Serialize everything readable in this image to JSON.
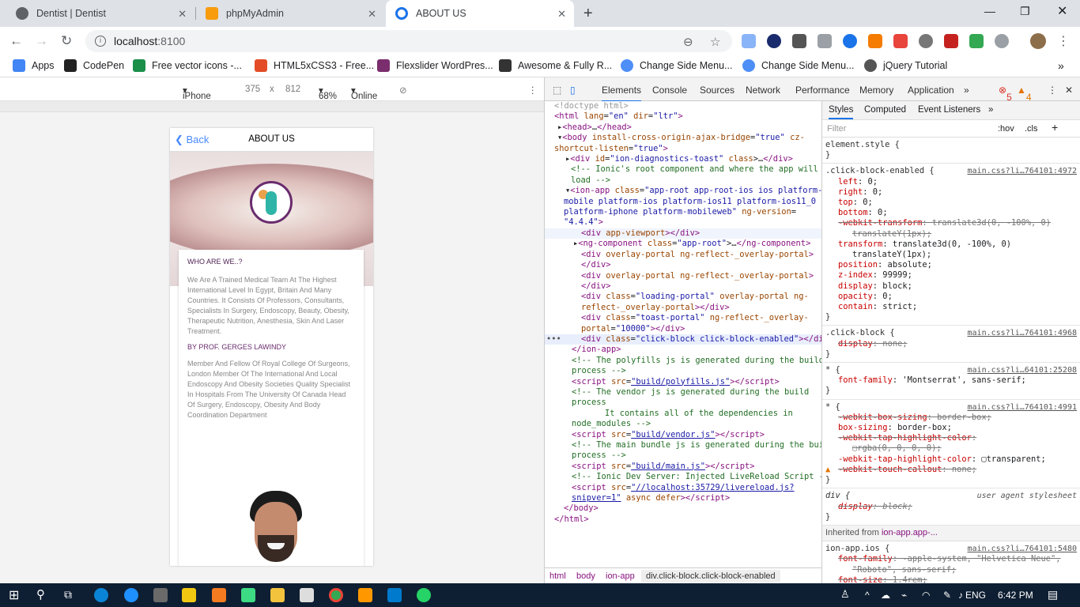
{
  "tabs": [
    {
      "title": "Dentist | Dentist",
      "icon": "globe-icon",
      "active": false
    },
    {
      "title": "phpMyAdmin",
      "icon": "phpmyadmin-icon",
      "active": false
    },
    {
      "title": "ABOUT US",
      "icon": "chrome-page-icon",
      "active": true
    }
  ],
  "address": {
    "host": "localhost",
    "port": ":8100"
  },
  "bookmarks": [
    {
      "label": "Apps",
      "icon": "apps-grid-icon",
      "color": "#4285f4"
    },
    {
      "label": "CodePen",
      "icon": "codepen-icon",
      "color": "#222222"
    },
    {
      "label": "Free vector icons -...",
      "icon": "vector-icon",
      "color": "#1a8f4a"
    },
    {
      "label": "HTML5xCSS3 - Free...",
      "icon": "x-icon",
      "color": "#e34c26"
    },
    {
      "label": "Flexslider WordPres...",
      "icon": "wordpress-icon",
      "color": "#7b2e6e"
    },
    {
      "label": "Awesome & Fully R...",
      "icon": "swirl-icon",
      "color": "#333333"
    },
    {
      "label": "Change Side Menu...",
      "icon": "ionic-icon",
      "color": "#4e8ef7"
    },
    {
      "label": "Change Side Menu...",
      "icon": "ionic-icon",
      "color": "#4e8ef7"
    },
    {
      "label": "jQuery Tutorial",
      "icon": "jquery-icon",
      "color": "#555555"
    }
  ],
  "device": {
    "model": "iPhone X",
    "width": "375",
    "x": "x",
    "height": "812",
    "zoom": "68%",
    "network": "Online"
  },
  "phone": {
    "back": "Back",
    "title": "ABOUT US",
    "heading1": "WHO ARE WE..?",
    "para1": "We Are A Trained Medical Team At The Highest International Level In Egypt, Britain And Many Countries. It Consists Of Professors, Consultants, Specialists In Surgery, Endoscopy, Beauty, Obesity, Therapeutic Nutrition, Anesthesia, Skin And Laser Treatment.",
    "heading2": "BY PROF. GERGES LAWINDY",
    "para2": "Member And Fellow Of Royal College Of Surgeons, London Member Of The International And Local Endoscopy And Obesity Societies Quality Specialist In Hospitals From The University Of Canada Head Of Surgery, Endoscopy, Obesity And Body Coordination Department"
  },
  "devtools": {
    "tabs": [
      "Elements",
      "Console",
      "Sources",
      "Network",
      "Performance",
      "Memory",
      "Application",
      "»"
    ],
    "errors": "5",
    "warnings": "4",
    "breadcrumb": [
      "html",
      "body",
      "ion-app",
      "div.click-block.click-block-enabled"
    ],
    "styles_tabs": [
      "Styles",
      "Computed",
      "Event Listeners",
      "»"
    ],
    "filter_placeholder": "Filter",
    "hov": ":hov",
    "cls": ".cls",
    "inherited_label": "Inherited from",
    "inherited_from": "ion-app.app-..."
  },
  "taskbar": {
    "lang": "ENG",
    "time": "6:42 PM"
  }
}
